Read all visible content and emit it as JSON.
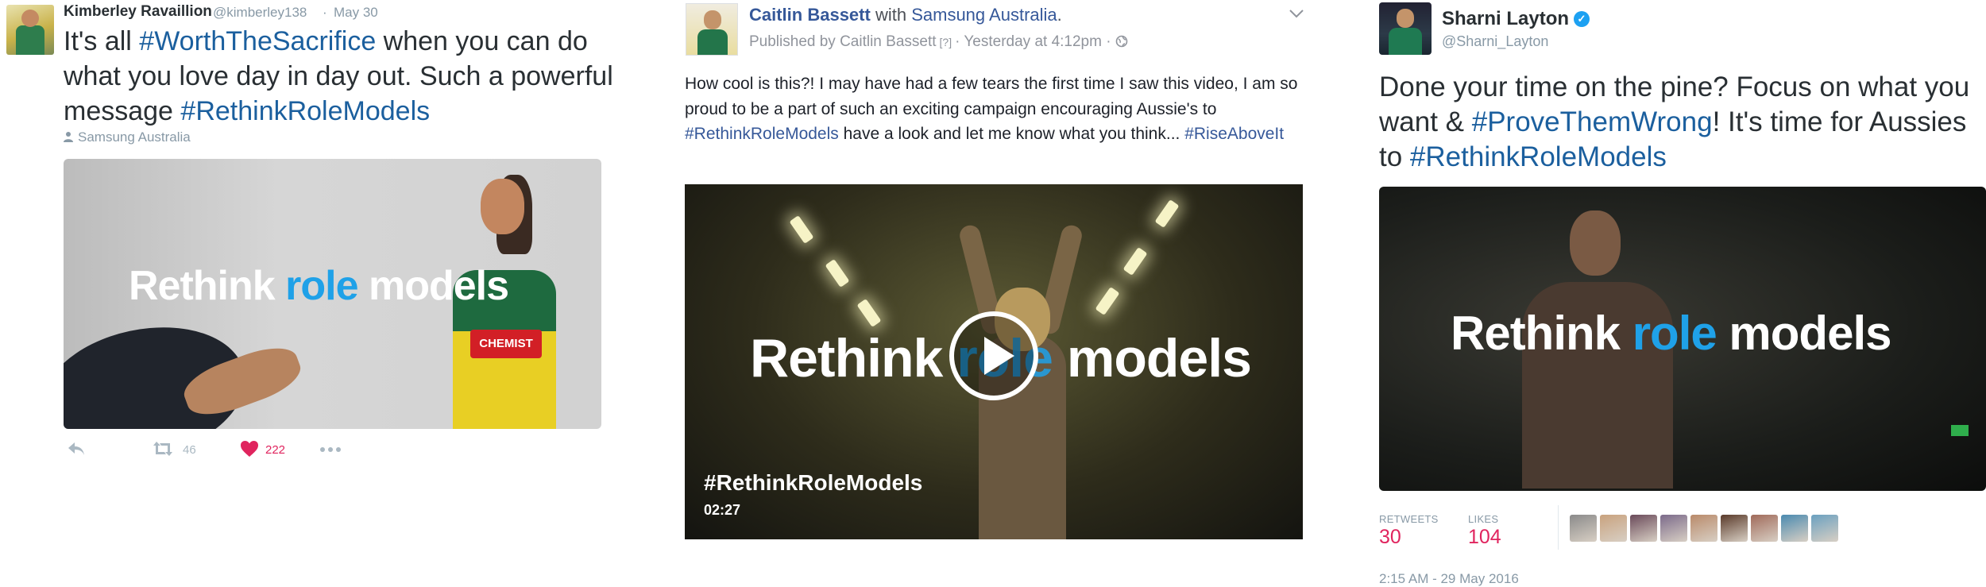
{
  "panel1": {
    "author_name": "Kimberley Ravaillion",
    "author_handle": "@kimberley138",
    "separator": "·",
    "date": "May 30",
    "text_before": "It's all ",
    "hashtag1": "#WorthTheSacrifice",
    "text_middle": " when you can do what you love day in day out. Such a powerful message ",
    "hashtag2": "#RethinkRoleModels",
    "location": "Samsung Australia",
    "media_text_a": "Rethink ",
    "media_text_b": "role",
    "media_text_c": " models",
    "jersey_text": "CHEMIST",
    "retweet_count": "46",
    "like_count": "222",
    "icons": [
      "reply-icon",
      "retweet-icon",
      "heart-icon",
      "more-icon"
    ]
  },
  "panel2": {
    "author_name": "Caitlin Bassett",
    "with_word": "with",
    "page_name": "Samsung Australia",
    "published_by": "Published by Caitlin Bassett",
    "help_marker": "[?]",
    "timestamp": "Yesterday at 4:12pm",
    "text_a": "How cool is this?! I may have had a few tears the first time I saw this video, I am so proud to be a part of such an exciting campaign encouraging Aussie's to ",
    "hashtag1": "#RethinkRoleModels",
    "text_b": " have a look and let me know what you think... ",
    "hashtag2": "#RiseAboveIt",
    "video_text_a": "Rethink ",
    "video_text_b": "role",
    "video_text_c": " models",
    "video_title": "#RethinkRoleModels",
    "video_duration": "02:27",
    "icons": [
      "chevron-down-icon",
      "globe-icon",
      "play-icon"
    ]
  },
  "panel3": {
    "author_name": "Sharni Layton",
    "author_handle": "@Sharni_Layton",
    "text_a": "Done your time on the pine? Focus on what you want & ",
    "hashtag1": "#ProveThemWrong",
    "text_b": "! It's time for Aussies to ",
    "hashtag2": "#RethinkRoleModels",
    "media_text_a": "Rethink ",
    "media_text_b": "role",
    "media_text_c": " models",
    "retweets_label": "RETWEETS",
    "retweets_value": "30",
    "likes_label": "LIKES",
    "likes_value": "104",
    "timestamp": "2:15 AM - 29 May 2016",
    "liker_colors": [
      "#8a8a8a",
      "#c9a27e",
      "#6a4a5a",
      "#7b6a8a",
      "#b98a6a",
      "#5a3a2a",
      "#a06a5a",
      "#4a8ab0",
      "#6aa0c0"
    ],
    "icons": [
      "verified-icon"
    ]
  },
  "colors": {
    "hashtag": "#1b5f9e",
    "facebook_link": "#365899",
    "like_red": "#e0245e",
    "role_blue": "#1fa1e8",
    "verified_blue": "#1da1f2"
  }
}
